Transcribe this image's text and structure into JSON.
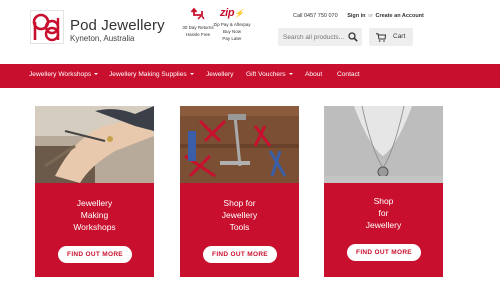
{
  "brand": {
    "name": "Pod Jewellery",
    "location": "Kyneton, Australia"
  },
  "promos": {
    "returns_line1": "30 Day Returns",
    "returns_line2": "Hassle Free",
    "zip_logo": "zip",
    "zip_line1": "Zip Pay & Afterpay",
    "zip_line2": "Buy Now",
    "zip_line3": "Pay Later"
  },
  "toplinks": {
    "call": "Call 0457 750 070",
    "signin": "Sign in",
    "or": "or",
    "create": "Create an Account"
  },
  "search": {
    "placeholder": "Search all products..."
  },
  "cart": {
    "label": "Cart"
  },
  "nav": {
    "items": [
      {
        "label": "Jewellery Workshops",
        "dropdown": true
      },
      {
        "label": "Jewellery Making Supplies",
        "dropdown": true
      },
      {
        "label": "Jewellery",
        "dropdown": false
      },
      {
        "label": "Gift Vouchers",
        "dropdown": true
      },
      {
        "label": "About",
        "dropdown": false
      },
      {
        "label": "Contact",
        "dropdown": false
      }
    ]
  },
  "cards": [
    {
      "title_lines": [
        "Jewellery",
        "Making",
        "Workshops"
      ],
      "button": "FIND OUT MORE"
    },
    {
      "title_lines": [
        "Shop for",
        "Jewellery",
        "Tools"
      ],
      "button": "FIND OUT MORE"
    },
    {
      "title_lines": [
        "Shop",
        "for",
        "Jewellery"
      ],
      "button": "FIND OUT MORE"
    }
  ],
  "colors": {
    "accent": "#c8102e",
    "panel_bg": "#eeeeee"
  }
}
